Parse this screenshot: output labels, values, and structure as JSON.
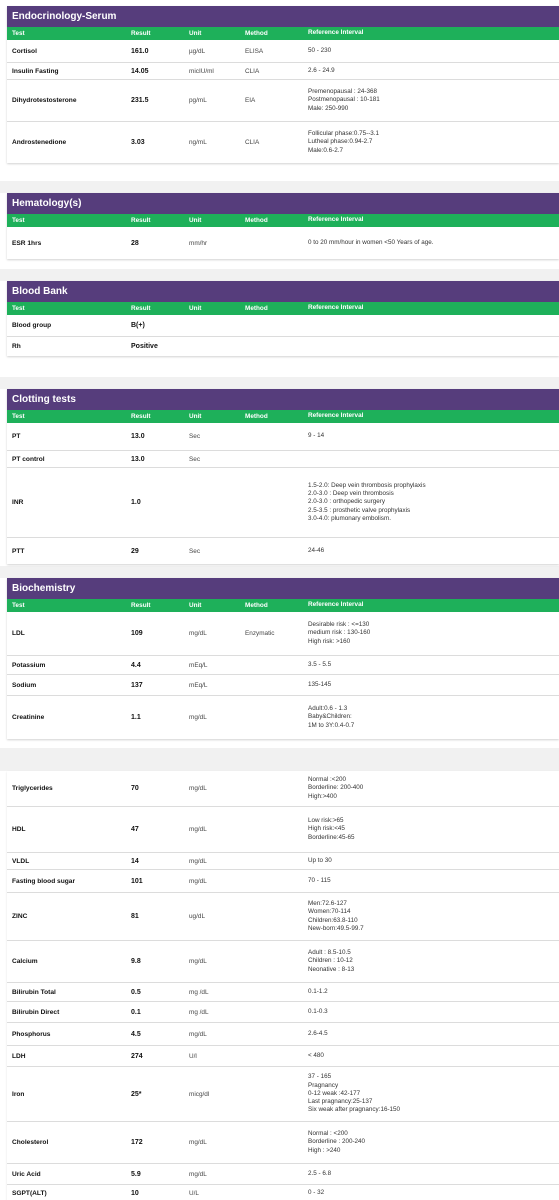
{
  "columns": {
    "test": "Test",
    "result": "Result",
    "unit": "Unit",
    "method": "Method",
    "reference": "Reference Interval"
  },
  "sections": [
    {
      "title": "Endocrinology-Serum",
      "rows": [
        {
          "test": "Cortisol",
          "result": "161.0",
          "unit": "µg/dL",
          "method": "ELISA",
          "ref": [
            "50 - 230"
          ]
        },
        {
          "test": "Insulin Fasting",
          "result": "14.05",
          "unit": "micIU/ml",
          "method": "CLIA",
          "ref": [
            "2.6 - 24.9"
          ]
        },
        {
          "test": "Dihydrotestosterone",
          "result": "231.5",
          "unit": "pg/mL",
          "method": "EIA",
          "ref": [
            "Premenopausal : 24-368",
            "Postmenopausal : 10-181",
            "Male: 250-990"
          ]
        },
        {
          "test": "Androstenedione",
          "result": "3.03",
          "unit": "ng/mL",
          "method": "CLIA",
          "ref": [
            "Follicular phase:0.75--3.1",
            "Lutheal phase:0.94-2.7",
            "Male:0.6-2.7"
          ]
        }
      ]
    },
    {
      "title": "Hematology(s)",
      "rows": [
        {
          "test": "ESR 1hrs",
          "result": "28",
          "unit": "mm/hr",
          "method": "",
          "ref": [
            "0 to 20 mm/hour in women <50 Years of age."
          ]
        }
      ]
    },
    {
      "title": "Blood Bank",
      "rows": [
        {
          "test": "Blood group",
          "result": "B(+)",
          "unit": "",
          "method": "",
          "ref": []
        },
        {
          "test": "Rh",
          "result": "Positive",
          "unit": "",
          "method": "",
          "ref": []
        }
      ]
    },
    {
      "title": "Clotting tests",
      "rows": [
        {
          "test": "PT",
          "result": "13.0",
          "unit": "Sec",
          "method": "",
          "ref": [
            "9 - 14"
          ]
        },
        {
          "test": "PT control",
          "result": "13.0",
          "unit": "Sec",
          "method": "",
          "ref": []
        },
        {
          "test": "INR",
          "result": "1.0",
          "unit": "",
          "method": "",
          "ref": [
            "1.5-2.0: Deep vein thrombosis prophylaxis",
            "2.0-3.0 : Deep vein thrombosis",
            "2.0-3.0 : orthopedic surgery",
            "2.5-3.5 : prosthetic valve prophylaxis",
            "3.0-4.0: plumonary embolism."
          ]
        },
        {
          "test": "PTT",
          "result": "29",
          "unit": "Sec",
          "method": "",
          "ref": [
            "24-46"
          ]
        }
      ]
    },
    {
      "title": "Biochemistry",
      "rows": [
        {
          "test": "LDL",
          "result": "109",
          "unit": "mg/dL",
          "method": "Enzymatic",
          "ref": [
            "Desirable risk : <=130",
            "medium risk : 130-160",
            "High risk: >160"
          ]
        },
        {
          "test": "Potassium",
          "result": "4.4",
          "unit": "mEq/L",
          "method": "",
          "ref": [
            "3.5 - 5.5"
          ]
        },
        {
          "test": "Sodium",
          "result": "137",
          "unit": "mEq/L",
          "method": "",
          "ref": [
            "135-145"
          ]
        },
        {
          "test": "Creatinine",
          "result": "1.1",
          "unit": "mg/dL",
          "method": "",
          "ref": [
            "Adult:0.6 - 1.3",
            "Baby&Children:",
            "1M to 3Y:0.4-0.7"
          ]
        }
      ]
    }
  ],
  "continued_rows": [
    {
      "test": "Triglycerides",
      "result": "70",
      "unit": "mg/dL",
      "ref": [
        "Normal :<200",
        "Borderline: 200-400",
        "High:>400"
      ]
    },
    {
      "test": "HDL",
      "result": "47",
      "unit": "mg/dL",
      "ref": [
        "Low risk:>65",
        "High risk:<45",
        "Borderline:45-65"
      ]
    },
    {
      "test": "VLDL",
      "result": "14",
      "unit": "mg/dL",
      "ref": [
        "Up to 30"
      ]
    },
    {
      "test": "Fasting blood sugar",
      "result": "101",
      "unit": "mg/dL",
      "ref": [
        "70 - 115"
      ]
    },
    {
      "test": "ZINC",
      "result": "81",
      "unit": "ug/dL",
      "ref": [
        "Men:72.6-127",
        "Women:70-114",
        "Children:63.8-110",
        "New-born:49.5-99.7"
      ]
    },
    {
      "test": "Calcium",
      "result": "9.8",
      "unit": "mg/dL",
      "ref": [
        "Adult : 8.5-10.5",
        "Children : 10-12",
        "Neonative : 8-13"
      ]
    },
    {
      "test": "Bilirubin Total",
      "result": "0.5",
      "unit": "mg /dL",
      "ref": [
        "0.1-1.2"
      ]
    },
    {
      "test": "Bilirubin Direct",
      "result": "0.1",
      "unit": "mg /dL",
      "ref": [
        "0.1-0.3"
      ]
    },
    {
      "test": "Phosphorus",
      "result": "4.5",
      "unit": "mg/dL",
      "ref": [
        "2.6-4.5"
      ]
    },
    {
      "test": "LDH",
      "result": "274",
      "unit": "U/l",
      "ref": [
        "< 480"
      ]
    },
    {
      "test": "Iron",
      "result": "25*",
      "unit": "micg/dl",
      "ref": [
        "37 - 165",
        "Pragnancy",
        "0-12 weak :42-177",
        "Last pragnancy:25-137",
        "Six weak after pragnancy:16-150"
      ]
    },
    {
      "test": "Cholesterol",
      "result": "172",
      "unit": "mg/dL",
      "ref": [
        "Normal : <200",
        "Borderline : 200-240",
        "High : >240"
      ]
    },
    {
      "test": "Uric Acid",
      "result": "5.9",
      "unit": "mg/dL",
      "ref": [
        "2.5 - 6.8"
      ]
    },
    {
      "test": "SGPT(ALT)",
      "result": "10",
      "unit": "U/L",
      "ref": [
        "0 - 32"
      ]
    }
  ]
}
